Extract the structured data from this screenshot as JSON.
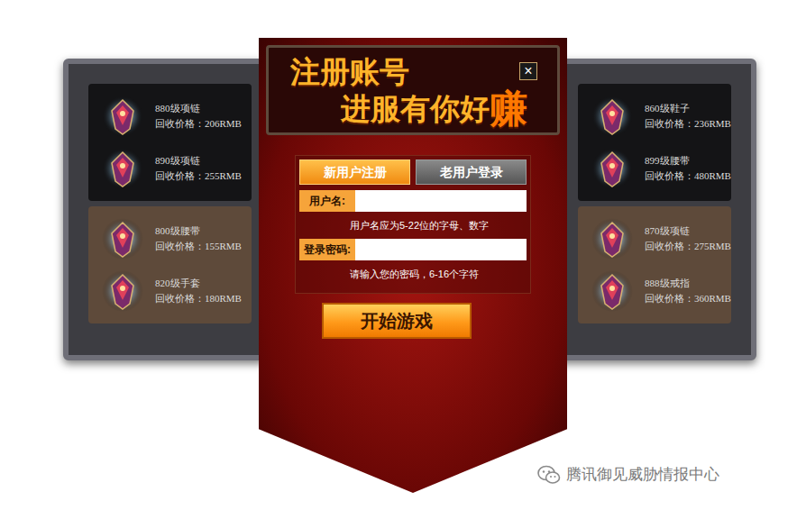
{
  "header": {
    "title": "注册账号",
    "subtitle": "进服有你好",
    "emphasis": "赚",
    "close": "×"
  },
  "tabs": [
    {
      "label": "新用户注册",
      "selected": true
    },
    {
      "label": "老用户登录",
      "selected": false
    }
  ],
  "fields": [
    {
      "label": "用户名:",
      "hint": "用户名应为5-22位的字母、数字"
    },
    {
      "label": "登录密码:",
      "hint": "请输入您的密码，6-16个字符"
    }
  ],
  "submit": "开始游戏",
  "left_items": [
    {
      "name": "880级项链",
      "price": "回收价格：206RMB"
    },
    {
      "name": "890级项链",
      "price": "回收价格：255RMB"
    },
    {
      "name": "800级腰带",
      "price": "回收价格：155RMB"
    },
    {
      "name": "820级手套",
      "price": "回收价格：180RMB"
    }
  ],
  "right_items": [
    {
      "name": "860级鞋子",
      "price": "回收价格：236RMB"
    },
    {
      "name": "899级腰带",
      "price": "回收价格：480RMB"
    },
    {
      "name": "870级项链",
      "price": "回收价格：275RMB"
    },
    {
      "name": "888级戒指",
      "price": "回收价格：360RMB"
    }
  ],
  "watermark": "腾讯御见威胁情报中心"
}
